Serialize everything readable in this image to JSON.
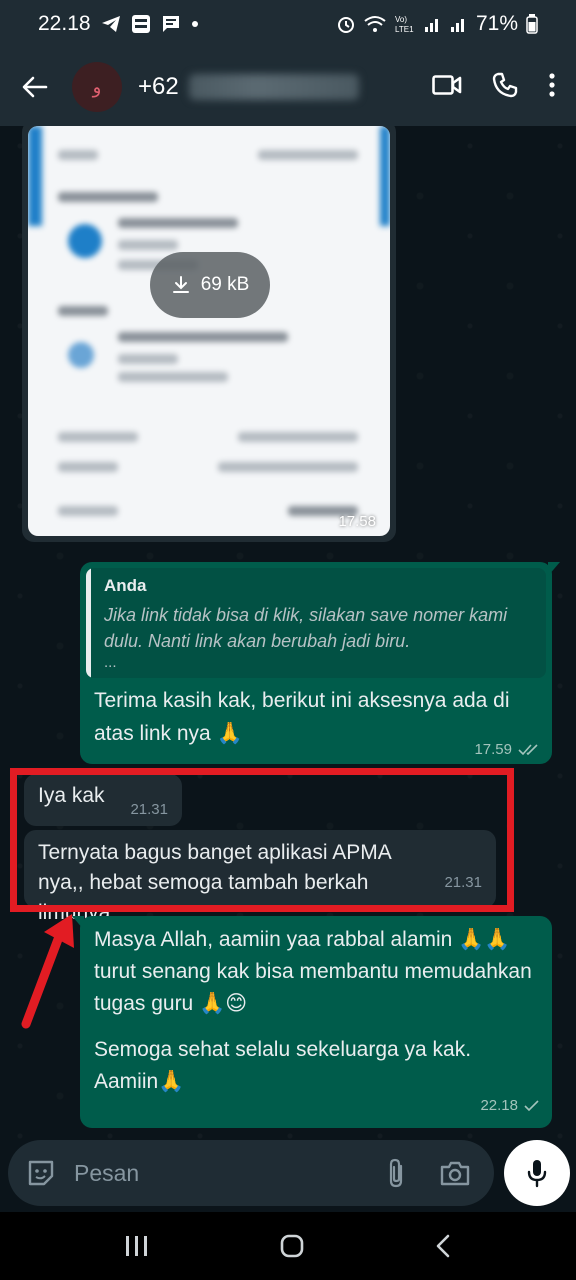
{
  "status_bar": {
    "time": "22.18",
    "notif_icons": [
      "telegram-icon",
      "brimo-icon",
      "message-icon",
      "dot-icon"
    ],
    "right_icons": [
      "alarm-icon",
      "wifi-icon",
      "volte-icon",
      "signal-icon",
      "signal-icon"
    ],
    "volte_label": "Vo)\nLTE1",
    "battery": "71%"
  },
  "header": {
    "avatar_letter": "و",
    "contact_prefix": "+62"
  },
  "messages": {
    "image": {
      "size_label": "69 kB",
      "time": "17.58"
    },
    "reply": {
      "quote_author": "Anda",
      "quote_text": "Jika link tidak bisa di klik, silakan save nomer kami dulu. Nanti link akan berubah jadi biru.",
      "quote_more": "...",
      "text": "Terima kasih kak, berikut ini aksesnya ada di atas link nya 🙏",
      "time": "17.59"
    },
    "incoming_1": {
      "text": "Iya kak",
      "time": "21.31"
    },
    "incoming_2": {
      "text": "Ternyata bagus banget aplikasi APMA nya,, hebat semoga tambah berkah ilmunya",
      "time": "21.31"
    },
    "outgoing_last": {
      "para1": "Masya Allah, aamiin yaa rabbal alamin 🙏🙏 turut senang kak bisa membantu memudahkan tugas guru 🙏😊",
      "para2": "Semoga sehat selalu sekeluarga ya kak. Aamiin🙏",
      "time": "22.18"
    }
  },
  "composer": {
    "placeholder": "Pesan"
  },
  "colors": {
    "highlight": "#e21c23",
    "outgoing": "#005c4b",
    "incoming": "#202c33"
  }
}
